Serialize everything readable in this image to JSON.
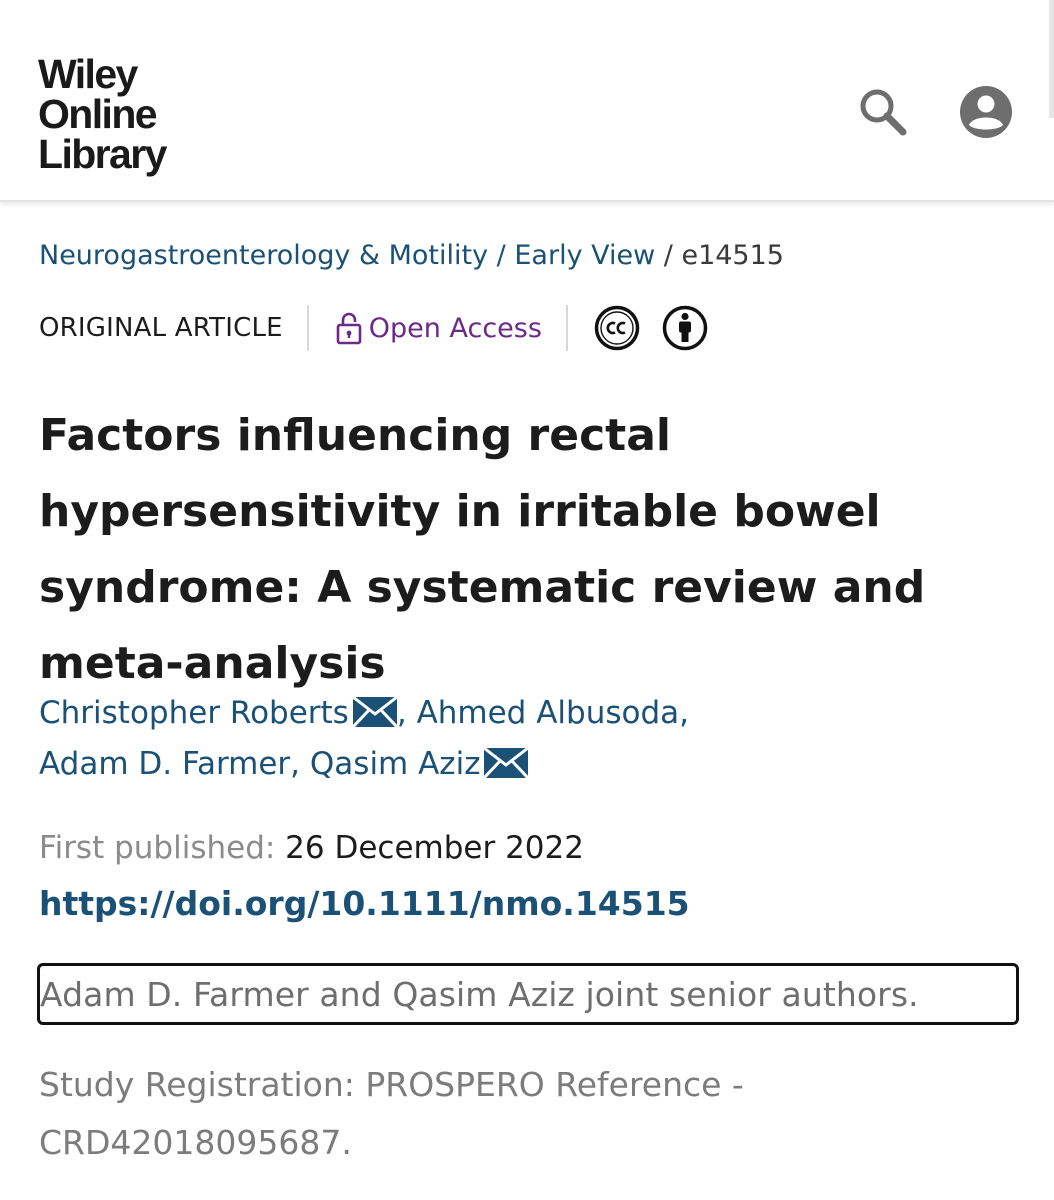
{
  "header": {
    "logo_lines": [
      "Wiley",
      "Online",
      "Library"
    ],
    "search_icon": "search-icon",
    "account_icon": "account-circle-icon"
  },
  "breadcrumb": {
    "journal": "Neurogastroenterology & Motility",
    "sep1": " / ",
    "issue": "Early View",
    "sep2": " / ",
    "article_id": " e14515"
  },
  "meta": {
    "article_type": "ORIGINAL ARTICLE",
    "access_label": "Open Access",
    "access_icon": "open-lock-icon",
    "license_icons": [
      "creative-commons-icon",
      "attribution-icon"
    ]
  },
  "article": {
    "title": "Factors influencing rectal hypersensitivity in irritable bowel syndrome: A systematic review and meta-analysis"
  },
  "authors": [
    {
      "name": "Christopher Roberts",
      "has_email": true
    },
    {
      "name": "Ahmed Albusoda",
      "has_email": false
    },
    {
      "name": "Adam D. Farmer",
      "has_email": false
    },
    {
      "name": "Qasim Aziz",
      "has_email": true
    }
  ],
  "author_separators": [
    ",",
    " ",
    ",",
    " "
  ],
  "publication": {
    "first_published_label": "First published:",
    "first_published_date": " 26 December 2022",
    "doi": "https://doi.org/10.1111/nmo.14515"
  },
  "notes": {
    "senior_authors": "Adam D. Farmer and Qasim Aziz joint senior authors.",
    "registration": "Study Registration: PROSPERO Reference - CRD42018095687."
  },
  "colors": {
    "link_blue": "#1b5176",
    "open_access_purple": "#6b2a88",
    "muted_gray": "#8b8b8b"
  }
}
